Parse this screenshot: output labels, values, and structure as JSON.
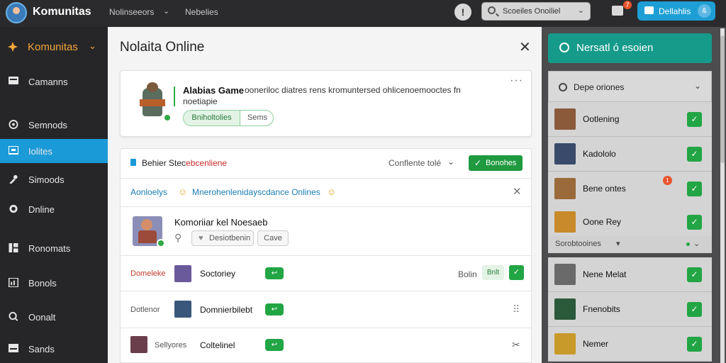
{
  "topbar": {
    "app_title": "Komunitas",
    "nav_1": "Nolinseeors",
    "nav_2": "Nebelies",
    "info_label": "!",
    "search_text": "Scoeiles Onoiliel",
    "notif_badge": "7",
    "primary_button": "Dellahlis",
    "user_initial": "&"
  },
  "sidebar": {
    "brand": "Komunitas",
    "items": [
      {
        "label": "Camanns",
        "icon": "message-icon"
      },
      {
        "label": "Semnods",
        "icon": "settings-icon"
      },
      {
        "label": "Iolites",
        "icon": "chat-icon"
      },
      {
        "label": "Simoods",
        "icon": "tool-icon"
      },
      {
        "label": "Dnline",
        "icon": "globe-icon"
      },
      {
        "label": "Ronomats",
        "icon": "grid-icon"
      },
      {
        "label": "Bonols",
        "icon": "table-icon"
      },
      {
        "label": "Oonalt",
        "icon": "search-icon"
      },
      {
        "label": "Sands",
        "icon": "image-icon"
      }
    ]
  },
  "main": {
    "title": "Nolaita Online",
    "card1": {
      "game_title": "Alabias Game",
      "description": "ooneriloc diatres rens kromuntersed ohlicenoemooctes fn",
      "description_2": "noetiapie",
      "tag_active": "Bniholtolies",
      "tag_other": "Sems",
      "more": "···"
    },
    "card2": {
      "header_prefix": "Behier Stec",
      "header_highlight": "ebcenliene",
      "filter_label": "Conflente tolé",
      "action_button": "Bonohes",
      "alert_label": "Aonloelys",
      "alert_text": "Mnerohenlenidayscdance Onlines",
      "featured_title": "Komoriiar kel Noesaeb",
      "featured_tag_1": "Desiotbenin",
      "featured_tag_2": "Cave",
      "row_status": "Bolin",
      "row_bit": "Bnlt",
      "rows": [
        {
          "label": "Domeleke",
          "name": "Soctoriey",
          "color": "#c23a2c"
        },
        {
          "label": "Dotlenor",
          "name": "Domnierbilebt",
          "color": "#555555"
        },
        {
          "label": "Sellyores",
          "name": "Coltelinel",
          "color": "#555555"
        }
      ]
    }
  },
  "right_panel": {
    "button_label": "Nersatl ó esoien",
    "header_label": "Depe oriones",
    "sub_label": "Sorobtooines",
    "badge": "1",
    "items": [
      {
        "name": "Ootlening"
      },
      {
        "name": "Kadololo"
      },
      {
        "name": "Bene ontes"
      },
      {
        "name": "Oone Rey"
      },
      {
        "name": "Nene Melat"
      },
      {
        "name": "Fnenobits"
      },
      {
        "name": "Nemer"
      }
    ]
  },
  "colors": {
    "accent_blue": "#1b9ad8",
    "brand_orange": "#f3a53a",
    "success_green": "#22a544",
    "teal": "#169a8a"
  }
}
